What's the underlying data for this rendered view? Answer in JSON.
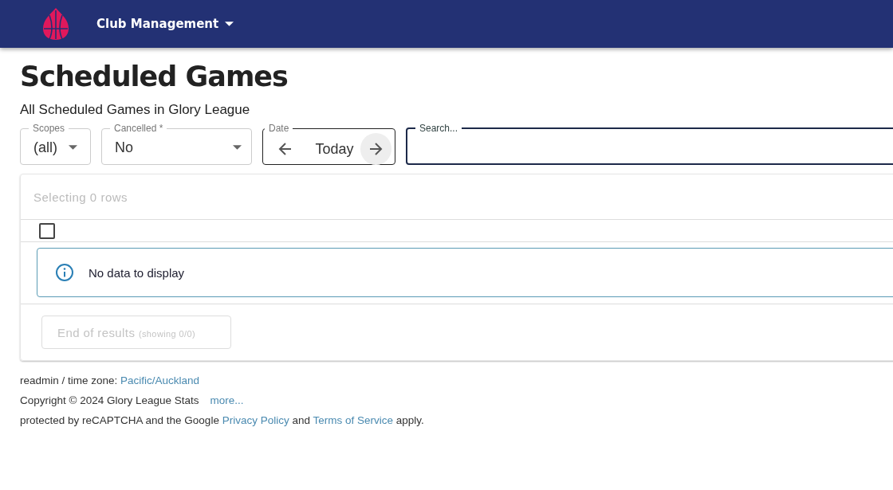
{
  "header": {
    "menu": "Club Management"
  },
  "page": {
    "title": "Scheduled Games",
    "subtitle": "All Scheduled Games in Glory League"
  },
  "filters": {
    "scopes": {
      "label": "Scopes",
      "value": "(all)"
    },
    "cancelled": {
      "label": "Cancelled *",
      "value": "No"
    },
    "date": {
      "label": "Date",
      "value": "Today"
    },
    "search": {
      "label": "Search..."
    }
  },
  "table": {
    "selection": "Selecting 0 rows",
    "select_all": {
      "checked": false
    },
    "empty_message": "No data to display",
    "end_button": {
      "label": "End of results",
      "detail": "(showing 0/0)",
      "disabled": true
    }
  },
  "footer": {
    "user_line": {
      "text": "readmin / time zone:",
      "timezone_link": "Pacific/Auckland"
    },
    "copyright_line": {
      "text": "Copyright © 2024 Glory League Stats",
      "more_link": "more..."
    },
    "recaptcha_line": {
      "text": "protected by reCAPTCHA and the Google",
      "privacy_link": "Privacy Policy",
      "middle": "and",
      "terms_link": "Terms of Service",
      "end": "apply."
    }
  }
}
